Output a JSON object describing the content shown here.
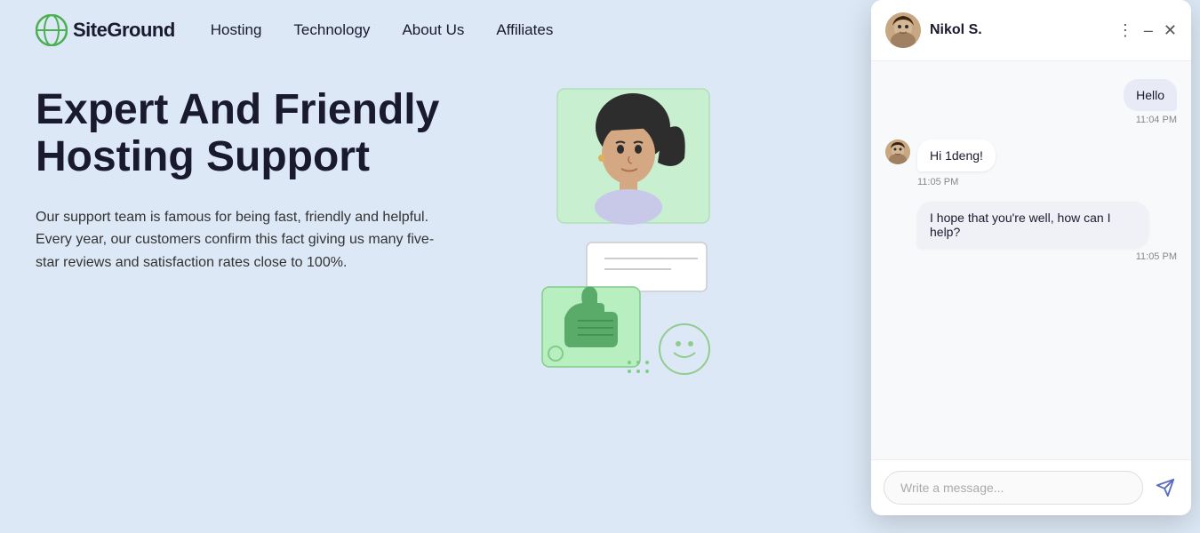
{
  "nav": {
    "logo_text": "SiteGround",
    "links": [
      {
        "label": "Hosting",
        "id": "hosting"
      },
      {
        "label": "Technology",
        "id": "technology"
      },
      {
        "label": "About Us",
        "id": "about-us"
      },
      {
        "label": "Affiliates",
        "id": "affiliates"
      }
    ]
  },
  "hero": {
    "title": "Expert And Friendly Hosting Support",
    "description": "Our support team is famous for being fast, friendly and helpful. Every year, our customers confirm this fact giving us many five-star reviews and satisfaction rates close to 100%."
  },
  "chat": {
    "agent_name": "Nikol S.",
    "messages": [
      {
        "type": "user",
        "text": "Hello",
        "time": "11:04 PM"
      },
      {
        "type": "agent",
        "text": "Hi 1deng!",
        "time": "11:05 PM"
      },
      {
        "type": "agent_block",
        "text": "I hope that you're well, how can I help?",
        "time": "11:05 PM"
      }
    ],
    "input_placeholder": "Write a message..."
  }
}
